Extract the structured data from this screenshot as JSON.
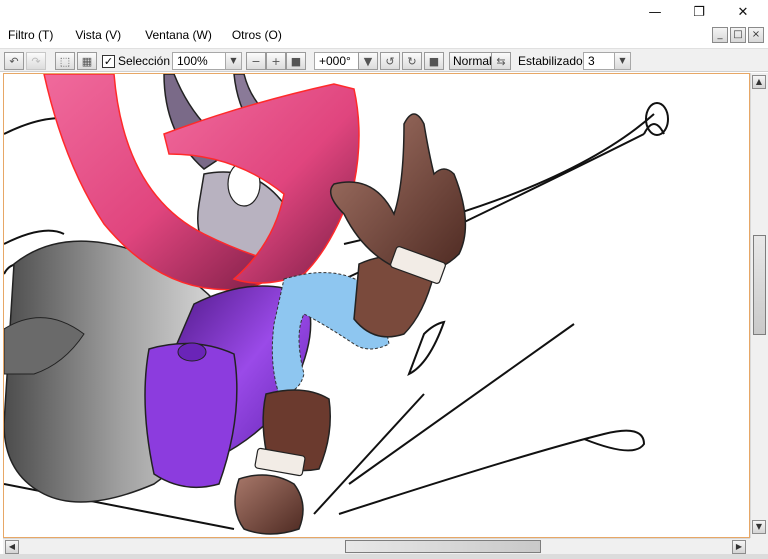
{
  "window_controls": {
    "minimize": "—",
    "restore": "❐",
    "close": "✕"
  },
  "menu": [
    {
      "label": "Filtro (T)"
    },
    {
      "label": "Vista (V)"
    },
    {
      "label": "Ventana (W)"
    },
    {
      "label": "Otros (O)"
    }
  ],
  "toolbar": {
    "seleccion_checked": true,
    "seleccion_label": "Selección",
    "zoom_value": "100%",
    "rotation_value": "+000°",
    "blend_button": "Normal",
    "stabilizer_label": "Estabilizador",
    "stabilizer_value": "3"
  },
  "colors": {
    "scarf": "#e0457e",
    "scarf_outline": "#ff2a2a",
    "tunic": "#7a2fd0",
    "sleeve": "#8ec6f0",
    "glove": "#6b3a2e",
    "canvas_border": "#e7a766"
  },
  "icons": [
    "undo-icon",
    "redo-icon",
    "select-all-icon",
    "deselect-icon",
    "zoom-out-icon",
    "zoom-in-icon",
    "zoom-fit-icon",
    "rotate-left-icon",
    "rotate-right-icon",
    "rotate-reset-icon",
    "flip-icon"
  ]
}
